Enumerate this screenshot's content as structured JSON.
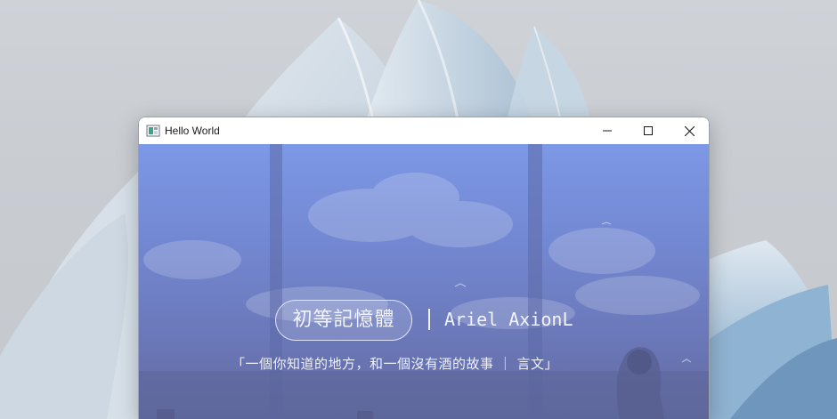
{
  "window": {
    "title": "Hello World",
    "controls": {
      "minimize_icon": "minimize-icon",
      "maximize_icon": "maximize-icon",
      "close_icon": "close-icon"
    }
  },
  "content": {
    "tag": "初等記憶體",
    "author": "Ariel AxionL",
    "quote": "「一個你知道的地方，和一個沒有酒的故事 ｜ 言文」"
  },
  "colors": {
    "titlebar": "#ffffff",
    "content_top": "#7d98e6",
    "content_bottom": "#626a9f",
    "text": "#f1f3ff"
  }
}
